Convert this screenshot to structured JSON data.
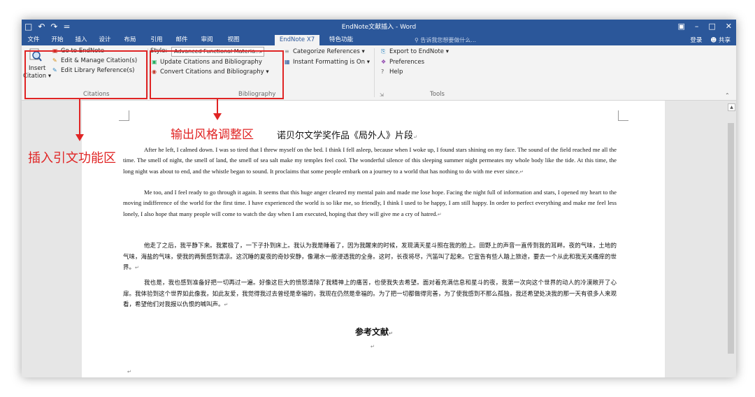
{
  "window": {
    "title": "EndNote文献插入 - Word",
    "qat": [
      "□",
      "↶",
      "↷",
      "="
    ],
    "controls": [
      "▣",
      "–",
      "□",
      "✕"
    ]
  },
  "menu": {
    "tabs": [
      "文件",
      "开始",
      "插入",
      "设计",
      "布局",
      "引用",
      "邮件",
      "审阅",
      "视图",
      "EndNote X7",
      "特色功能"
    ],
    "active_tab": "EndNote X7",
    "tell_me": "告诉我您想要做什么...",
    "login": "登录",
    "share": "共享"
  },
  "ribbon": {
    "insert_citation": [
      "Insert",
      "Citation ▾"
    ],
    "citations_items": [
      "Go to EndNote",
      "Edit & Manage Citation(s)",
      "Edit Library Reference(s)"
    ],
    "citations_label": "Citations",
    "style_label": "Style:",
    "style_value": "Advanced Functional Materia...",
    "update_citations": "Update Citations and Bibliography",
    "convert_citations": "Convert Citations and Bibliography ▾",
    "categorize_references": "Categorize References ▾",
    "instant_formatting": "Instant Formatting is On ▾",
    "bibliography_label": "Bibliography",
    "export_to_endnote": "Export to EndNote ▾",
    "preferences": "Preferences",
    "help": "Help",
    "tools_label": "Tools",
    "colors": {
      "brand": "#2b579a",
      "annotation": "#e02424"
    }
  },
  "annotations": {
    "insert_citation_area": "插入引文功能区",
    "output_style_area": "输出风格调整区"
  },
  "document": {
    "title": "诺贝尔文学奖作品《局外人》片段",
    "para_en_1": "After he left, I calmed down. I was so tired that I threw myself on the bed. I think I fell asleep, because when I woke up, I found stars shining on my face. The sound of the field reached me all the time. The smell of night, the smell of land, the smell of sea salt make my temples feel cool. The wonderful silence of this sleeping summer night permeates my whole body like the tide. At this time, the long night was about to end, and the whistle began to sound. It proclaims that some people embark on a journey to a world that has nothing to do with me ever since.",
    "para_en_2": "Me too, and I feel ready to go through it again. It seems that this huge anger cleared my mental pain and made me lose hope. Facing the night full of information and stars, I opened my heart to the moving indifference of the world for the first time. I have experienced the world is so like me, so friendly, I think I used to be happy, I am still happy. In order to perfect everything and make me feel less lonely, I also hope that many people will come to watch the day when I am executed, hoping that they will give me a cry of hatred.",
    "para_cn_1": "他走了之后，我平静下来。我累极了，一下子扑到床上。我认为我是睡着了，因为我醒来的时候，发现满天星斗照在我的脸上。田野上的声音一直传到我的耳畔。夜的气味，土地的气味，海盐的气味，使我的两鬓感到清凉。这沉睡的夏夜的奇妙安静，像潮水一般浸透我的全身。这时，长夜将尽，汽笛叫了起来。它宣告有些人踏上旅途，要去一个从此和我无关痛痒的世界。",
    "para_cn_2": "我也是，我也感到准备好把一切再过一遍。好像这巨大的愤怒清除了我精神上的痛苦，也使我失去希望。面对着充满信息和星斗的夜，我第一次向这个世界的动人的冷漠敞开了心扉。我体验到这个世界如此像我，如此友爱，我觉得我过去曾经是幸福的，我现在仍然是幸福的。为了把一切都做得完善，为了使我感到不那么孤独，我还希望处决我的那一天有很多人来观看，希望他们对我报以仇恨的喊叫声。",
    "references": "参考文献",
    "para_mark": "↵"
  }
}
